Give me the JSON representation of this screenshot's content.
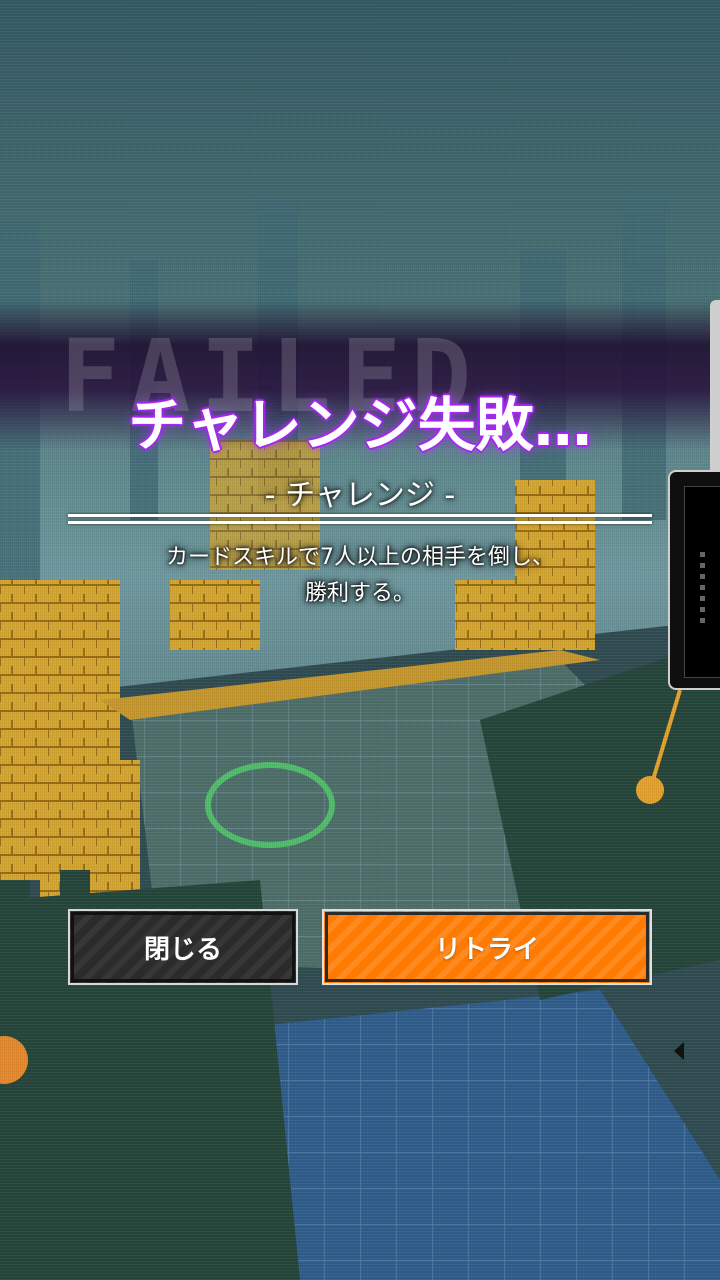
{
  "result": {
    "watermark": "FAILED",
    "title": "チャレンジ失敗…",
    "subtitle": "- チャレンジ -",
    "description_lines": [
      "カードスキルで7人以上の相手を倒し、",
      "勝利する。"
    ]
  },
  "buttons": {
    "close_label": "閉じる",
    "retry_label": "リトライ"
  },
  "colors": {
    "title_glow": "#a020f0",
    "retry_button": "#ff7a00",
    "close_button": "#2b2b2b"
  },
  "icons": {
    "side_panel_arrow": "caret-left-icon"
  }
}
